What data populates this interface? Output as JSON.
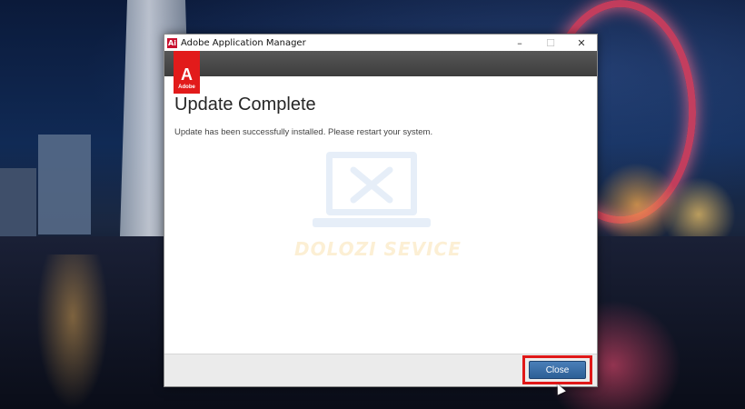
{
  "window": {
    "title": "Adobe Application Manager",
    "app_icon_glyph": "Ai",
    "controls": {
      "minimize": "–",
      "maximize": "☐",
      "close": "✕"
    }
  },
  "logo": {
    "glyph": "A",
    "word": "Adobe",
    "color": "#e21b1b"
  },
  "content": {
    "heading": "Update Complete",
    "message": "Update has been successfully installed. Please restart your system."
  },
  "watermark": {
    "text": "DOLOZI SEVICE",
    "icon": "laptop-tools-icon"
  },
  "footer": {
    "close_label": "Close",
    "accent": "#2d5f96",
    "highlight_color": "#e01818"
  }
}
